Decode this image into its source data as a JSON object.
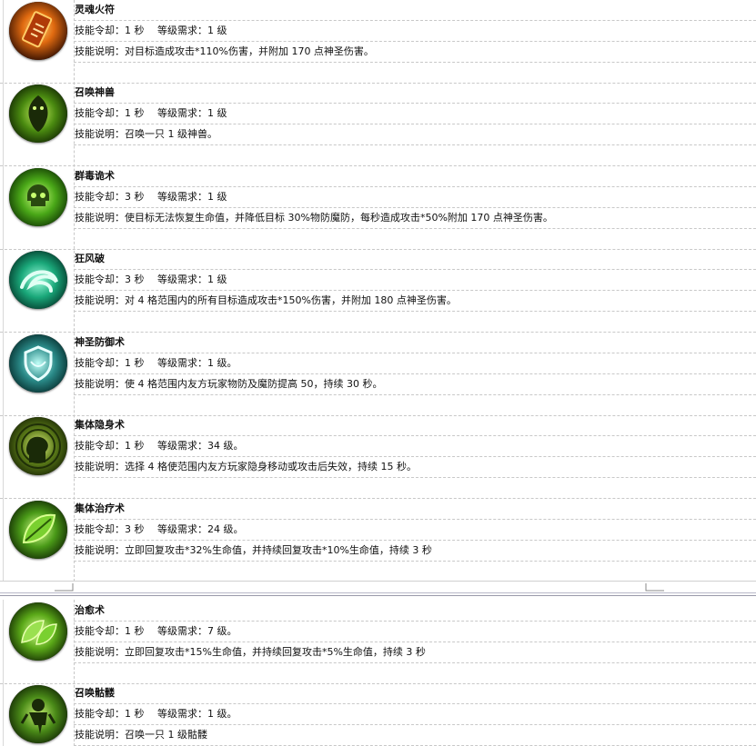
{
  "skills_top": [
    {
      "name": "灵魂火符",
      "cooldown": "技能令却：1 秒　 等级需求：1 级",
      "desc": "技能说明：对目标造成攻击*110%伤害，并附加 170 点神圣伤害。",
      "icon": "fire-talisman-icon",
      "color": "#e06a10"
    },
    {
      "name": "召唤神兽",
      "cooldown": "技能令却：1 秒　 等级需求：1 级",
      "desc": "技能说明：召唤一只 1 级神兽。",
      "icon": "summon-beast-icon",
      "color": "#5a9a10"
    },
    {
      "name": "群毒诡术",
      "cooldown": "技能令却：3 秒　 等级需求：1 级",
      "desc": "技能说明：使目标无法恢复生命值，并降低目标 30%物防魔防，每秒造成攻击*50%附加 170 点神圣伤害。",
      "icon": "poison-skull-icon",
      "color": "#4aa818"
    },
    {
      "name": "狂风破",
      "cooldown": "技能令却：3 秒　 等级需求：1 级",
      "desc": "技能说明：对 4 格范围内的所有目标造成攻击*150%伤害，并附加 180 点神圣伤害。",
      "icon": "whirlwind-icon",
      "color": "#1aa87a"
    },
    {
      "name": "神圣防御术",
      "cooldown": "技能令却：1 秒　 等级需求：1 级。",
      "desc": "技能说明：使 4 格范围内友方玩家物防及魔防提高 50，持续 30 秒。",
      "icon": "holy-shield-icon",
      "color": "#2a8a88"
    },
    {
      "name": "集体隐身术",
      "cooldown": "技能令却：1 秒　 等级需求：34 级。",
      "desc": "技能说明：选择 4 格使范围内友方玩家隐身移动或攻击后失效，持续 15 秒。",
      "icon": "invisibility-head-icon",
      "color": "#5a7a18"
    },
    {
      "name": "集体治疗术",
      "cooldown": "技能令却：3 秒　 等级需求：24 级。",
      "desc": "技能说明：立即回复攻击*32%生命值，并持续回复攻击*10%生命值，持续 3 秒",
      "icon": "group-heal-leaf-icon",
      "color": "#4a9a18"
    }
  ],
  "skills_bottom": [
    {
      "name": "治愈术",
      "cooldown": "技能令却：1 秒　 等级需求：7 级。",
      "desc": "技能说明：立即回复攻击*15%生命值，并持续回复攻击*5%生命值，持续 3 秒",
      "icon": "heal-leaves-icon",
      "color": "#5aa818"
    },
    {
      "name": "召唤骷髅",
      "cooldown": "技能令却：1 秒　 等级需求：1 级。",
      "desc": "技能说明：召唤一只 1 级骷髅",
      "icon": "summon-skeleton-icon",
      "color": "#4a8a18"
    }
  ]
}
